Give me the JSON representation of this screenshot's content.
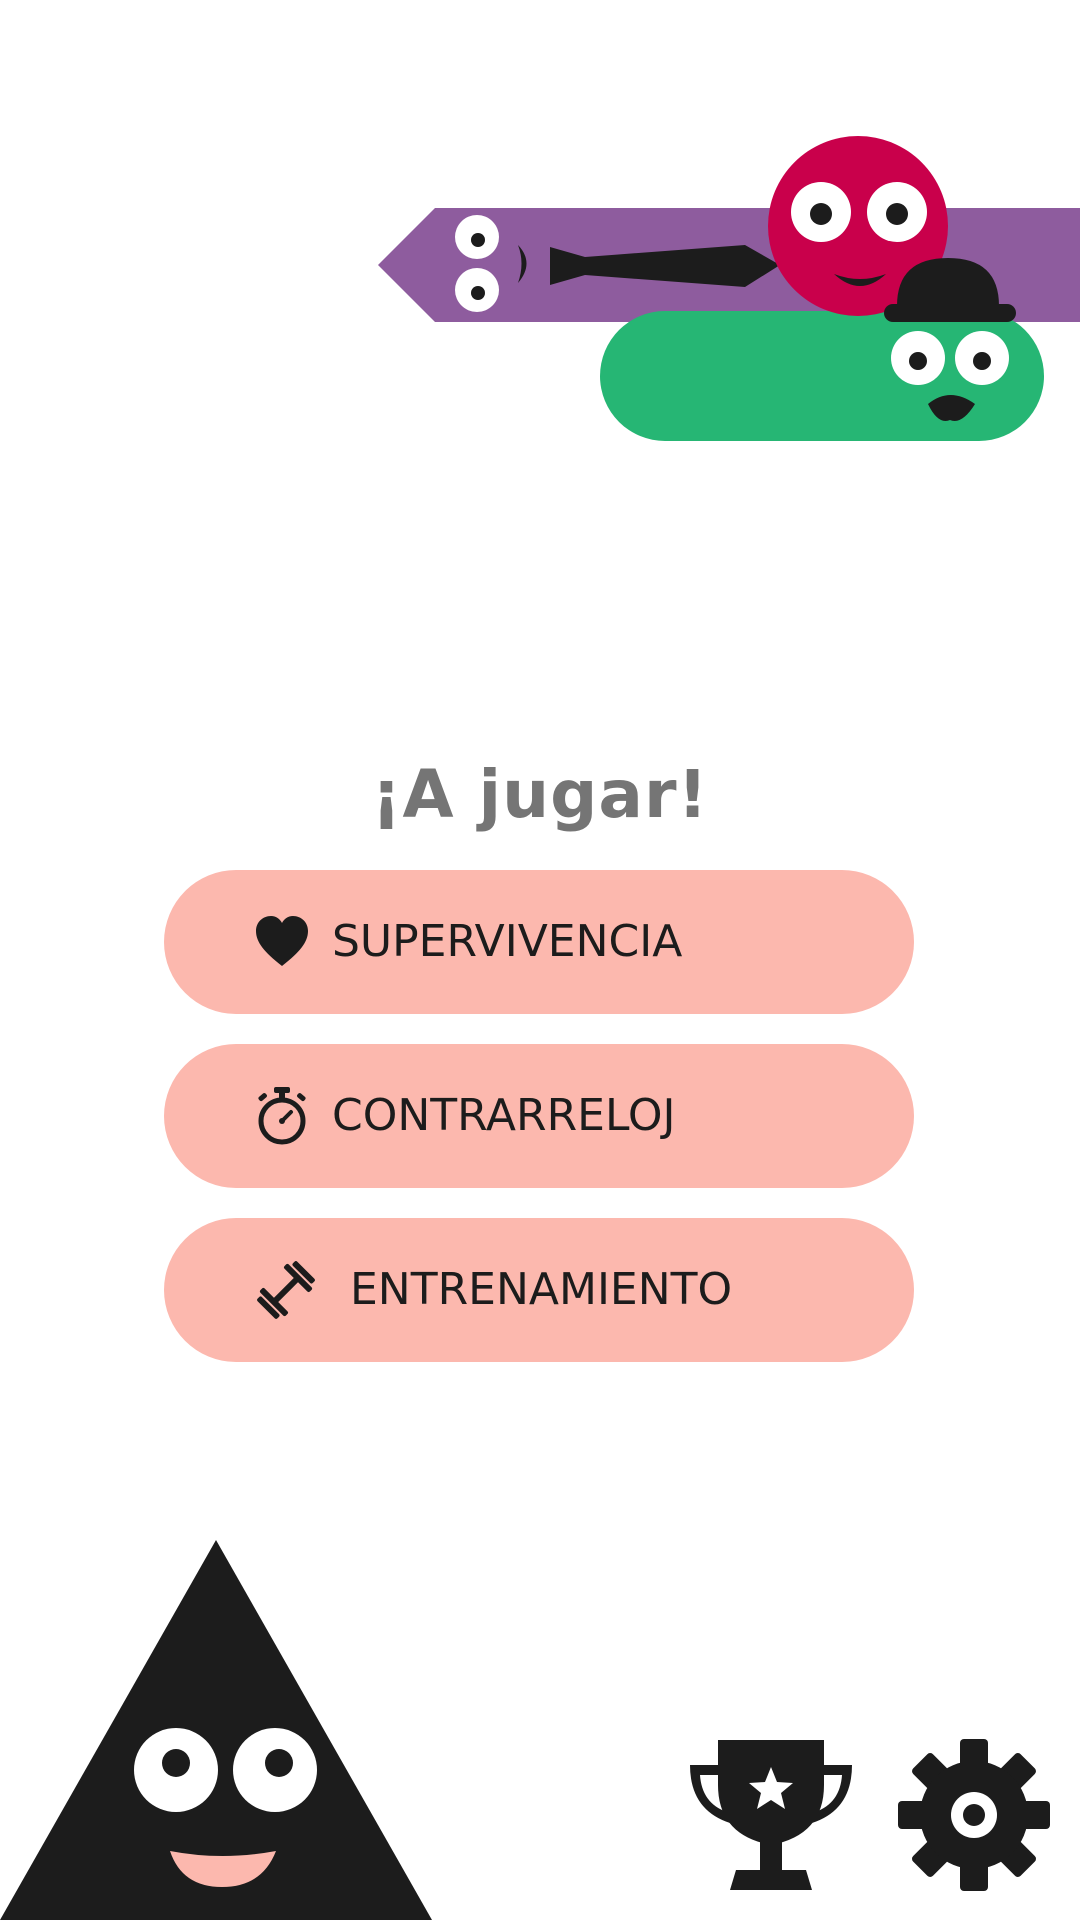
{
  "colors": {
    "background": "#ffffff",
    "title_text": "#757575",
    "button_fill": "#fcb8ae",
    "button_text": "#1c1c1c",
    "icon_dark": "#1c1c1c",
    "purple_character": "#8e5c9e",
    "red_character": "#c9004b",
    "green_character": "#26b674",
    "mascot_smile": "#fcb8ae"
  },
  "menu": {
    "title": "¡A jugar!",
    "modes": [
      {
        "label": "SUPERVIVENCIA",
        "icon": "heart-icon"
      },
      {
        "label": "CONTRARRELOJ",
        "icon": "stopwatch-icon"
      },
      {
        "label": "ENTRENAMIENTO",
        "icon": "dumbbell-icon"
      }
    ]
  },
  "footer": {
    "trophy_icon": "trophy-icon",
    "settings_icon": "gear-icon"
  }
}
